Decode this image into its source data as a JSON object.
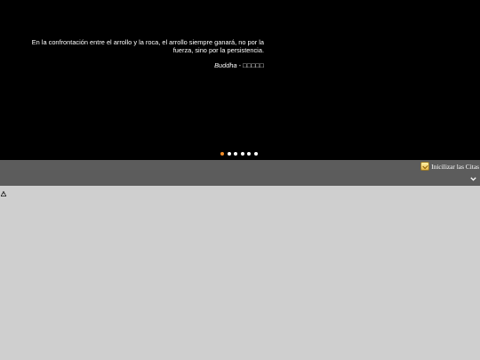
{
  "quote": {
    "text": "En la confrontación entre el arrollo y la roca, el arrollo siempre ganará, no por la fuerza, sino por la persistencia.",
    "author": "Buddha",
    "separator": " - ",
    "source_glyphs": "□□□□□"
  },
  "carousel": {
    "dots": [
      {
        "label": "slide-1",
        "active": true
      },
      {
        "label": "slide-2",
        "active": false
      },
      {
        "label": "slide-3",
        "active": false
      },
      {
        "label": "slide-4",
        "active": false
      },
      {
        "label": "slide-5",
        "active": false
      },
      {
        "label": "slide-6",
        "active": false
      }
    ],
    "active_color": "#f28c28",
    "inactive_color": "#ffffff"
  },
  "toolbar": {
    "init_label": "Inicilizar las Citas",
    "init_icon": "init-quotes-icon",
    "expand_icon": "chevron-down-icon"
  },
  "content": {
    "status_icon": "warning-icon"
  },
  "colors": {
    "hero_bg": "#000000",
    "toolbar_bg": "#5c5c5c",
    "content_bg": "#cfcfcf"
  }
}
